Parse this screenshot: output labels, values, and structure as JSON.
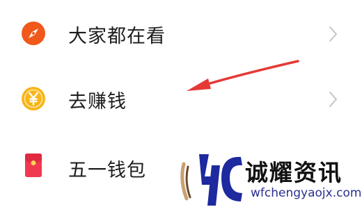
{
  "menu": {
    "items": [
      {
        "label": "大家都在看",
        "icon": "compass-icon",
        "icon_color": "#f0591b",
        "has_chevron": true
      },
      {
        "label": "去赚钱",
        "icon": "yuan-coin-icon",
        "icon_color": "#f8b51b",
        "has_chevron": true
      },
      {
        "label": "五一钱包",
        "icon": "red-envelope-icon",
        "icon_color": "#f0394f",
        "has_chevron": false
      }
    ]
  },
  "annotation": {
    "icon": "red-arrow-icon",
    "color": "#e53935"
  },
  "watermark": {
    "title": "诚耀资讯",
    "url": "wfchengyaojx.com",
    "logo": "4c-logo-icon",
    "brand_color": "#1e2a9e"
  }
}
